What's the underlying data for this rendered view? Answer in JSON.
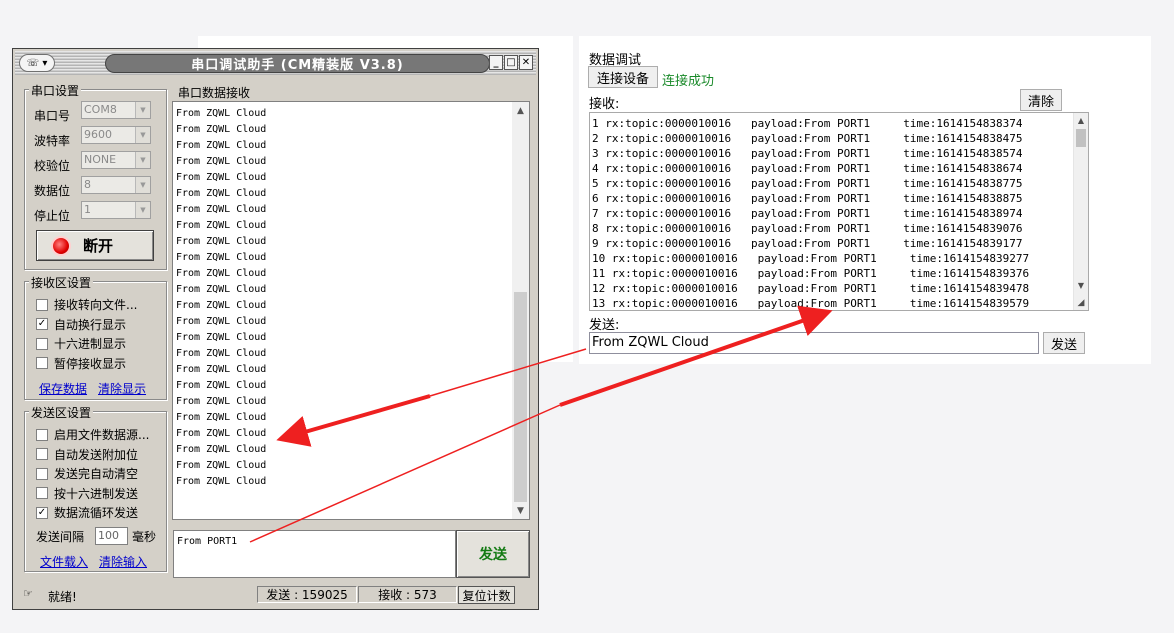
{
  "web_panel": {
    "title": "数据调试",
    "connect_button": "连接设备",
    "connect_status": "连接成功",
    "receive_label": "接收:",
    "clear_button": "清除",
    "receive_lines": [
      "1 rx:topic:0000010016   payload:From PORT1     time:1614154838374",
      "2 rx:topic:0000010016   payload:From PORT1     time:1614154838475",
      "3 rx:topic:0000010016   payload:From PORT1     time:1614154838574",
      "4 rx:topic:0000010016   payload:From PORT1     time:1614154838674",
      "5 rx:topic:0000010016   payload:From PORT1     time:1614154838775",
      "6 rx:topic:0000010016   payload:From PORT1     time:1614154838875",
      "7 rx:topic:0000010016   payload:From PORT1     time:1614154838974",
      "8 rx:topic:0000010016   payload:From PORT1     time:1614154839076",
      "9 rx:topic:0000010016   payload:From PORT1     time:1614154839177",
      "10 rx:topic:0000010016   payload:From PORT1     time:1614154839277",
      "11 rx:topic:0000010016   payload:From PORT1     time:1614154839376",
      "12 rx:topic:0000010016   payload:From PORT1     time:1614154839478",
      "13 rx:topic:0000010016   payload:From PORT1     time:1614154839579"
    ],
    "send_label": "发送:",
    "send_input_value": "From ZQWL Cloud",
    "send_button": "发送"
  },
  "serial_window": {
    "title": "串口调试助手 (CM精装版 V3.8)",
    "sysmenu_glyph": "☏ ▾",
    "title_buttons": {
      "minimize": "_",
      "maximize": "□",
      "close": "✕"
    },
    "serial_group": {
      "title": "串口设置",
      "port_label": "串口号",
      "port_value": "COM8",
      "baud_label": "波特率",
      "baud_value": "9600",
      "parity_label": "校验位",
      "parity_value": "NONE",
      "databits_label": "数据位",
      "databits_value": "8",
      "stopbits_label": "停止位",
      "stopbits_value": "1",
      "toggle_button": "断开"
    },
    "receive_group": {
      "title": "接收区设置",
      "options": [
        {
          "label": "接收转向文件...",
          "checked": false
        },
        {
          "label": "自动换行显示",
          "checked": true
        },
        {
          "label": "十六进制显示",
          "checked": false
        },
        {
          "label": "暂停接收显示",
          "checked": false
        }
      ],
      "save_link": "保存数据",
      "clear_link": "清除显示"
    },
    "send_group": {
      "title": "发送区设置",
      "options": [
        {
          "label": "启用文件数据源...",
          "checked": false
        },
        {
          "label": "自动发送附加位",
          "checked": false
        },
        {
          "label": "发送完自动清空",
          "checked": false
        },
        {
          "label": "按十六进制发送",
          "checked": false
        },
        {
          "label": "数据流循环发送",
          "checked": true
        }
      ],
      "interval_label": "发送间隔",
      "interval_value": "100",
      "interval_unit": "毫秒",
      "load_file_link": "文件载入",
      "clear_input_link": "清除输入"
    },
    "rx_title": "串口数据接收",
    "rx_lines": [
      "From ZQWL Cloud",
      "From ZQWL Cloud",
      "From ZQWL Cloud",
      "From ZQWL Cloud",
      "From ZQWL Cloud",
      "From ZQWL Cloud",
      "From ZQWL Cloud",
      "From ZQWL Cloud",
      "From ZQWL Cloud",
      "From ZQWL Cloud",
      "From ZQWL Cloud",
      "From ZQWL Cloud",
      "From ZQWL Cloud",
      "From ZQWL Cloud",
      "From ZQWL Cloud",
      "From ZQWL Cloud",
      "From ZQWL Cloud",
      "From ZQWL Cloud",
      "From ZQWL Cloud",
      "From ZQWL Cloud",
      "From ZQWL Cloud",
      "From ZQWL Cloud",
      "From ZQWL Cloud",
      "From ZQWL Cloud"
    ],
    "tx_text": "From PORT1",
    "send_button": "发送",
    "status": {
      "text": "就绪!",
      "sent": "发送 : 159025",
      "received": "接收 : 573",
      "reset_button": "复位计数"
    }
  },
  "annotation_colors": {
    "arrow": "#ee2020"
  }
}
